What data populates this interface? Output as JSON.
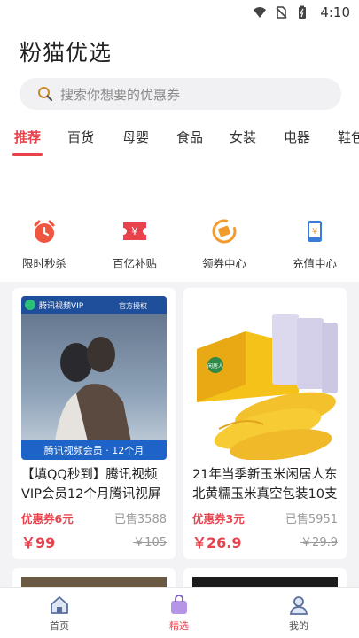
{
  "status": {
    "time": "4:10"
  },
  "app": {
    "title": "粉猫优选"
  },
  "search": {
    "placeholder": "搜索你想要的优惠券"
  },
  "tabs": [
    {
      "label": "推荐",
      "active": true
    },
    {
      "label": "百货"
    },
    {
      "label": "母婴"
    },
    {
      "label": "食品"
    },
    {
      "label": "女装"
    },
    {
      "label": "电器"
    },
    {
      "label": "鞋包"
    }
  ],
  "quick": [
    {
      "label": "限时秒杀",
      "icon": "alarm-clock-icon"
    },
    {
      "label": "百亿补贴",
      "icon": "yen-ticket-icon"
    },
    {
      "label": "领券中心",
      "icon": "coupon-circle-icon"
    },
    {
      "label": "充值中心",
      "icon": "phone-recharge-icon"
    }
  ],
  "products": [
    {
      "title": "【填QQ秒到】腾讯视频VIP会员12个月腾讯视屏",
      "coupon": "优惠券6元",
      "sold": "已售3588",
      "price": "￥99",
      "orig_price": "￥105",
      "image_text": {
        "brand": "腾讯视频VIP",
        "auth": "官方授权",
        "banner": "腾讯视频会员 · 12个月"
      }
    },
    {
      "title": "21年当季新玉米闲居人东北黄糯玉米真空包装10支",
      "coupon": "优惠券3元",
      "sold": "已售5951",
      "price": "￥26.9",
      "orig_price": "￥29.9",
      "image_text": {
        "brand": "闲居人"
      }
    }
  ],
  "nav": [
    {
      "label": "首页",
      "icon": "home-icon"
    },
    {
      "label": "精选",
      "icon": "shopping-bag-icon",
      "active": true
    },
    {
      "label": "我的",
      "icon": "user-icon"
    }
  ],
  "colors": {
    "accent": "#e8434d",
    "orange": "#f39a2d",
    "blue": "#3a7bd5"
  }
}
